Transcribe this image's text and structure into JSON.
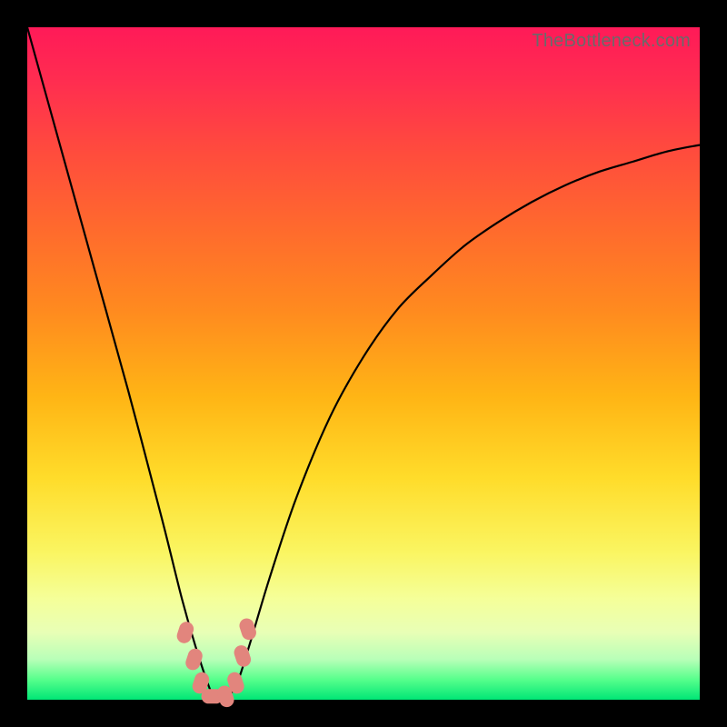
{
  "watermark": "TheBottleneck.com",
  "colors": {
    "gradient_top": "#ff1a58",
    "gradient_bottom": "#00e676",
    "curve": "#000000",
    "marker": "#e2857d",
    "frame": "#000000"
  },
  "chart_data": {
    "type": "line",
    "title": "",
    "xlabel": "",
    "ylabel": "",
    "xlim": [
      0,
      100
    ],
    "ylim": [
      0,
      100
    ],
    "grid": false,
    "legend": false,
    "description": "Single V-shaped bottleneck curve over a vertical red-to-green gradient; minimum near x≈28 at y≈0.",
    "x": [
      0,
      5,
      10,
      15,
      20,
      23,
      25,
      27,
      28,
      29,
      31,
      33,
      36,
      40,
      45,
      50,
      55,
      60,
      65,
      70,
      75,
      80,
      85,
      90,
      95,
      100
    ],
    "y": [
      100,
      82,
      64,
      46,
      27,
      15,
      8,
      2,
      0,
      0,
      2,
      8,
      18,
      30,
      42,
      51,
      58,
      63,
      67.5,
      71,
      74,
      76.5,
      78.5,
      80,
      81.5,
      82.5
    ],
    "minimum": {
      "x": 28,
      "y": 0
    },
    "markers": [
      {
        "x": 23.5,
        "y": 10
      },
      {
        "x": 24.8,
        "y": 6
      },
      {
        "x": 25.8,
        "y": 2.5
      },
      {
        "x": 27.5,
        "y": 0.5
      },
      {
        "x": 29.5,
        "y": 0.5
      },
      {
        "x": 31.0,
        "y": 2.5
      },
      {
        "x": 32.0,
        "y": 6.5
      },
      {
        "x": 32.8,
        "y": 10.5
      }
    ]
  }
}
